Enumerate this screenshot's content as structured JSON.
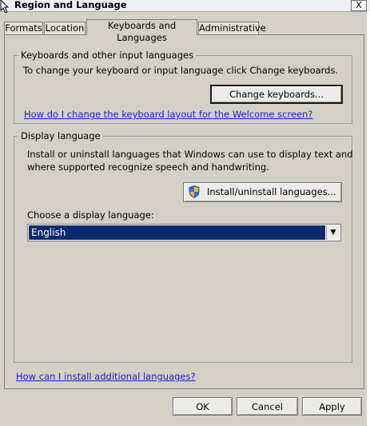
{
  "window": {
    "title": "Region and Language",
    "close_glyph": "X"
  },
  "tabs": [
    {
      "label": "Formats",
      "active": false
    },
    {
      "label": "Location",
      "active": false
    },
    {
      "label": "Keyboards and Languages",
      "active": true
    },
    {
      "label": "Administrative",
      "active": false
    }
  ],
  "keyboards_group": {
    "legend": "Keyboards and other input languages",
    "description": "To change your keyboard or input language click Change keyboards.",
    "change_button": "Change keyboards...",
    "help_link": "How do I change the keyboard layout for the Welcome screen?"
  },
  "display_group": {
    "legend": "Display language",
    "description_line1": "Install or uninstall languages that Windows can use to display text and",
    "description_line2": "where supported recognize speech and handwriting.",
    "install_button": "Install/uninstall languages...",
    "install_button_icon": "uac-shield-icon",
    "choose_label": "Choose a display language:",
    "selected_language": "English"
  },
  "footer": {
    "install_link": "How can I install additional languages?",
    "ok": "OK",
    "cancel": "Cancel",
    "apply": "Apply"
  }
}
